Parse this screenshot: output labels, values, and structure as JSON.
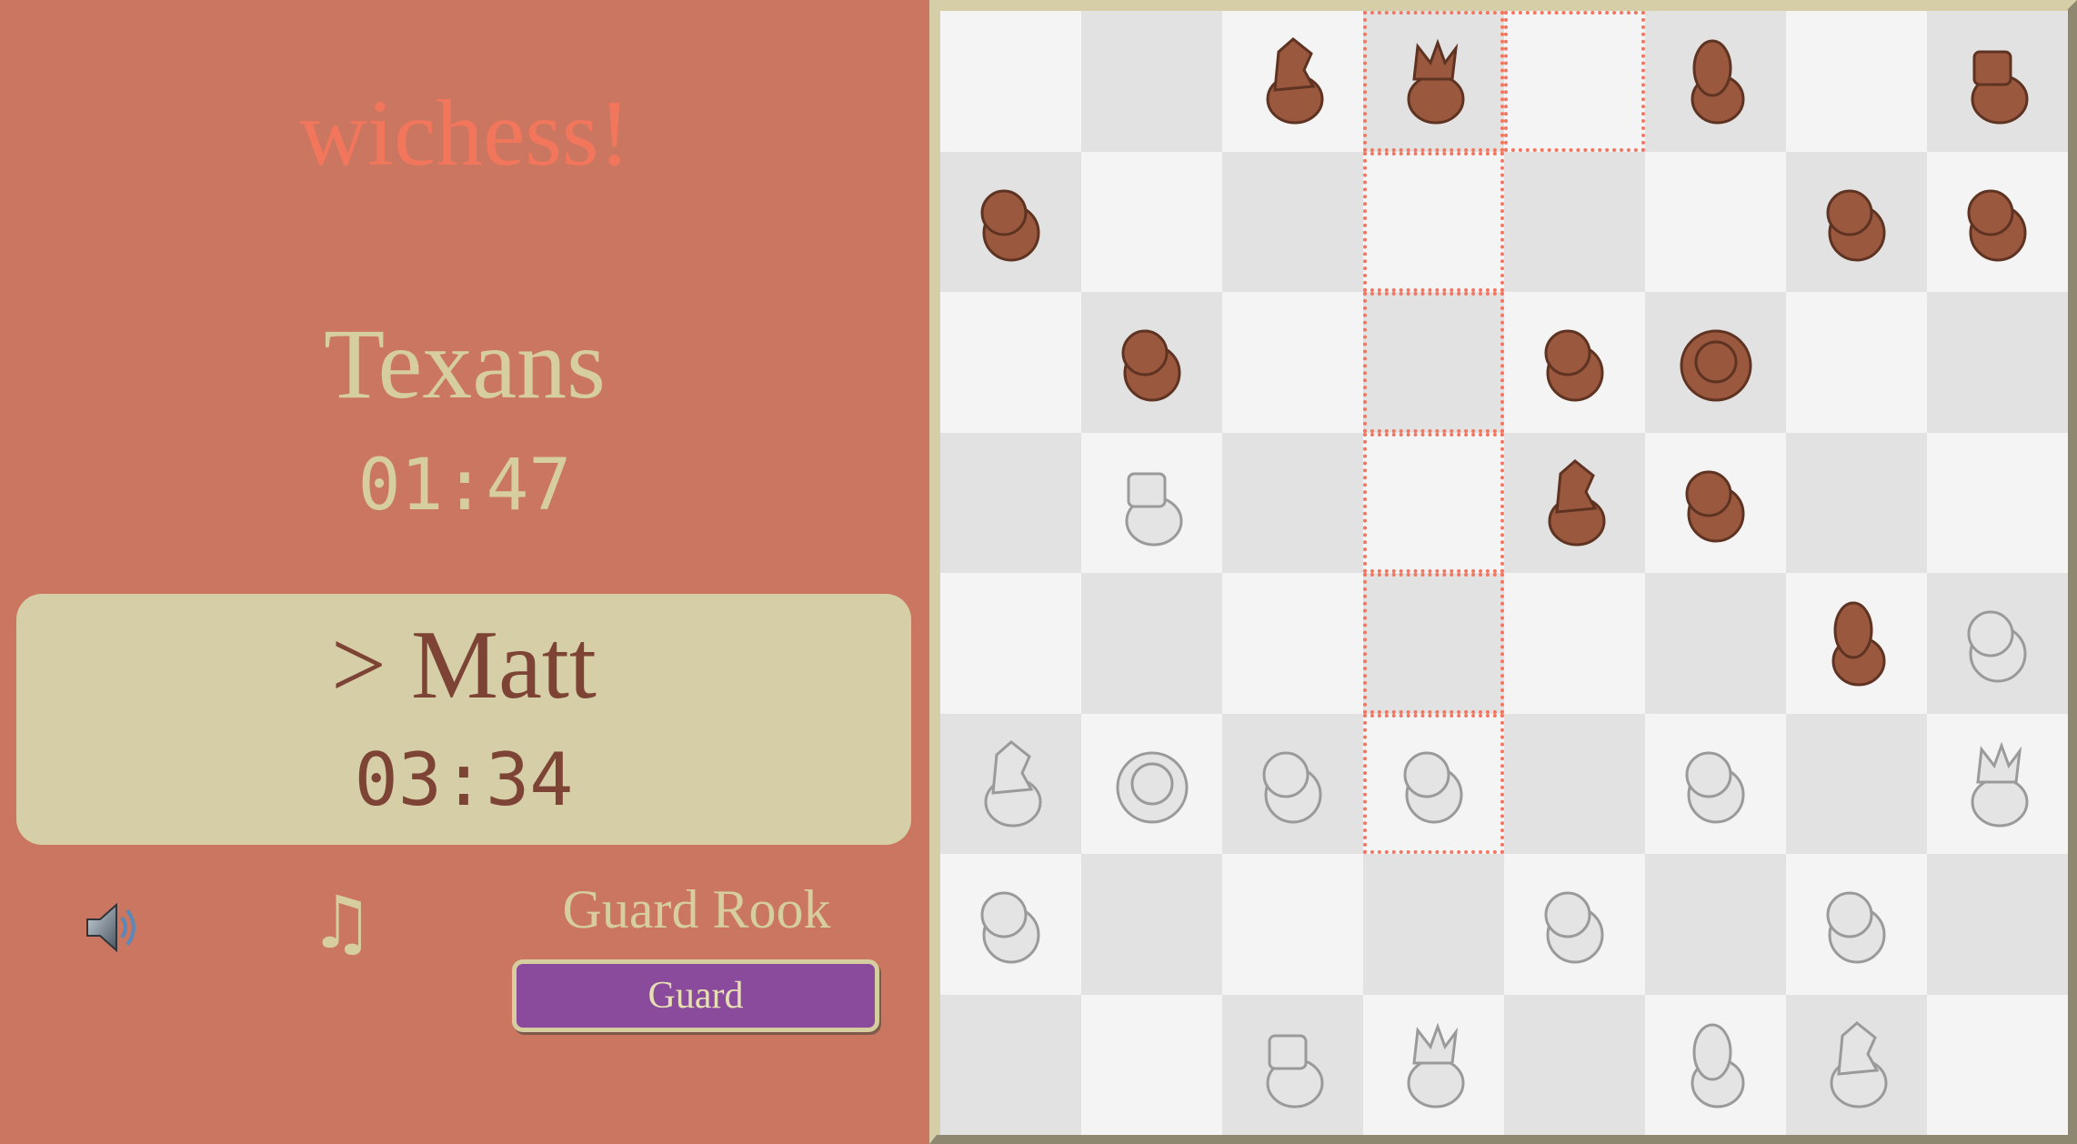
{
  "app": {
    "title": "wichess!"
  },
  "opponent": {
    "name": "Texans",
    "clock": "01:47"
  },
  "player": {
    "name": "> Matt",
    "clock": "03:34"
  },
  "controls": {
    "sound_icon": "speaker-icon",
    "music_icon": "music-note-icon",
    "music_glyph": "♫",
    "ability_label": "Guard Rook",
    "ability_button": "Guard"
  },
  "colors": {
    "panel_bg": "#ca7660",
    "title": "#f2765c",
    "cream": "#d6ce9f",
    "active_card": "#d6cea7",
    "active_text": "#7d4436",
    "button": "#8a4b9d",
    "highlight": "#f27660",
    "light_square": "#f4f4f4",
    "dark_square": "#e2e2e2",
    "brown_piece": "#9a583e",
    "white_piece": "#e4e4e4"
  },
  "board": {
    "rows": [
      [
        null,
        null,
        "bn",
        "bq",
        null,
        "bb",
        null,
        "br"
      ],
      [
        "bp",
        null,
        null,
        null,
        null,
        null,
        "bp",
        "bp"
      ],
      [
        null,
        "bp",
        null,
        null,
        "bp",
        "bk",
        null,
        null
      ],
      [
        null,
        "wr",
        null,
        null,
        "bn",
        "bp",
        null,
        null
      ],
      [
        null,
        null,
        null,
        null,
        null,
        null,
        "bb",
        "wp"
      ],
      [
        "wn",
        "wk",
        "wp",
        "wp",
        null,
        "wp",
        null,
        "wq"
      ],
      [
        "wp",
        null,
        null,
        null,
        "wp",
        null,
        "wp",
        null
      ],
      [
        null,
        null,
        "wr",
        "wq",
        null,
        "wb",
        "wn",
        null
      ]
    ],
    "highlighted": [
      [
        0,
        3
      ],
      [
        0,
        4
      ],
      [
        1,
        3
      ],
      [
        2,
        3
      ],
      [
        3,
        3
      ],
      [
        4,
        3
      ],
      [
        5,
        3
      ]
    ]
  }
}
